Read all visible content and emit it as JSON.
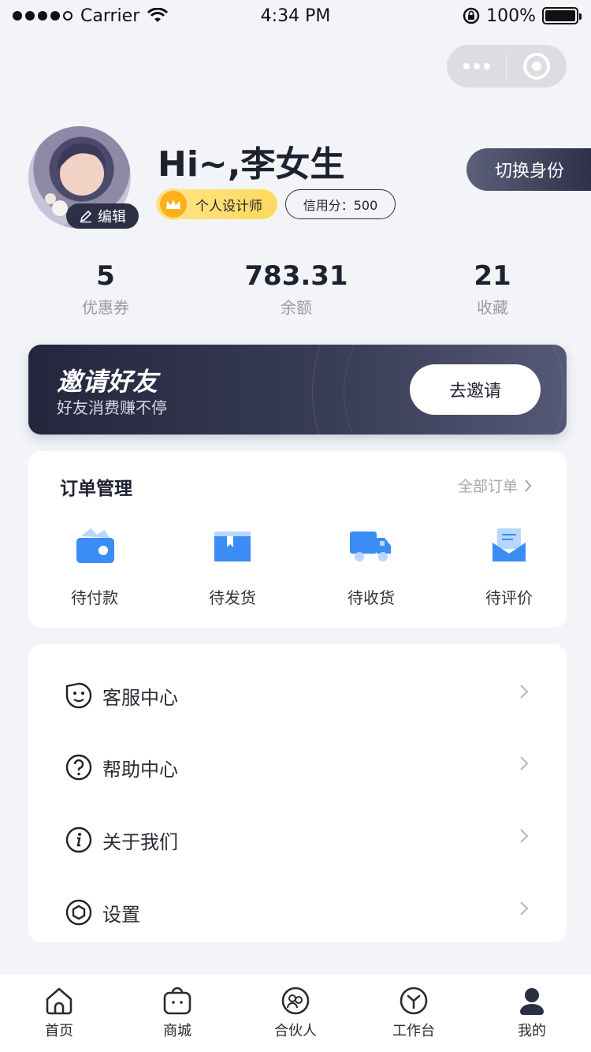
{
  "status_bar": {
    "carrier": "Carrier",
    "time": "4:34 PM",
    "battery": "100%",
    "icons": [
      "signal-dots-icon",
      "wifi-icon",
      "rotation-lock-icon",
      "battery-icon"
    ]
  },
  "profile": {
    "greeting": "Hi~,李女生",
    "edit_label": "编辑",
    "role_badge": "个人设计师",
    "credit_label": "信用分：500",
    "switch_button": "切换身份"
  },
  "stats": [
    {
      "value": "5",
      "label": "优惠券"
    },
    {
      "value": "783.31",
      "label": "余额"
    },
    {
      "value": "21",
      "label": "收藏"
    }
  ],
  "invite": {
    "title": "邀请好友",
    "subtitle": "好友消费赚不停",
    "button": "去邀请"
  },
  "orders": {
    "title": "订单管理",
    "all_link": "全部订单",
    "items": [
      {
        "label": "待付款",
        "icon": "wallet-icon"
      },
      {
        "label": "待发货",
        "icon": "box-icon"
      },
      {
        "label": "待收货",
        "icon": "truck-icon"
      },
      {
        "label": "待评价",
        "icon": "envelope-icon"
      }
    ]
  },
  "menu": {
    "items": [
      {
        "label": "客服中心",
        "icon": "customer-service-icon"
      },
      {
        "label": "帮助中心",
        "icon": "help-icon"
      },
      {
        "label": "关于我们",
        "icon": "info-icon"
      },
      {
        "label": "设置",
        "icon": "settings-icon"
      }
    ]
  },
  "tabbar": {
    "items": [
      {
        "label": "首页",
        "icon": "home-icon"
      },
      {
        "label": "商城",
        "icon": "shop-bag-icon"
      },
      {
        "label": "合伙人",
        "icon": "partner-icon"
      },
      {
        "label": "工作台",
        "icon": "workbench-icon"
      },
      {
        "label": "我的",
        "icon": "user-icon",
        "active": true
      }
    ]
  },
  "colors": {
    "background": "#f3f4f8",
    "dark": "#2c2f45",
    "accent_blue": "#3b8cf5",
    "gold": "#ffd95c"
  }
}
